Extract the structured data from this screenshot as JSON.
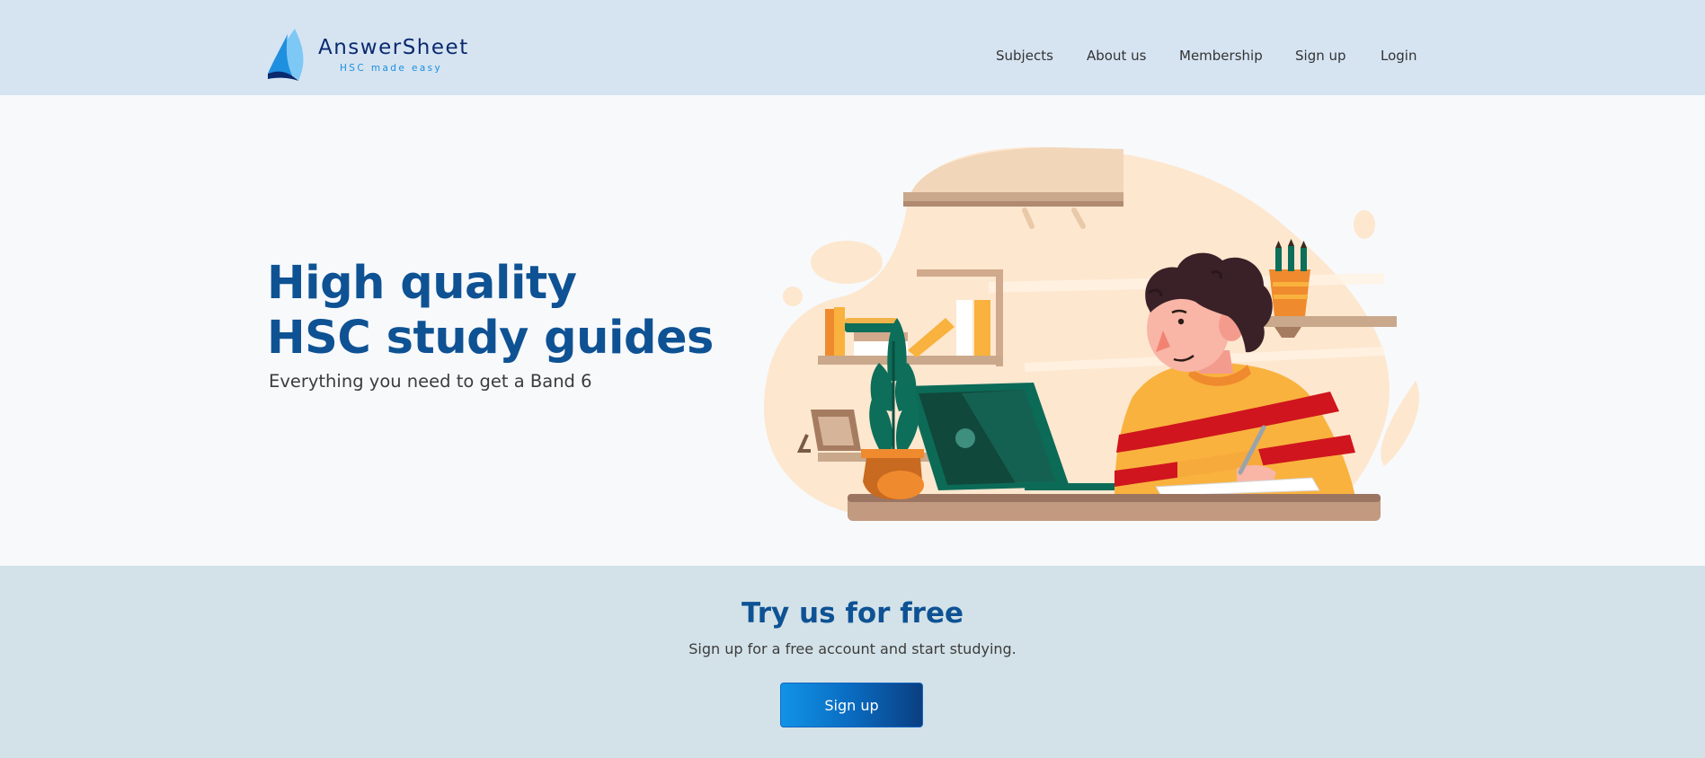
{
  "header": {
    "logo": {
      "name": "AnswerSheet",
      "tagline": "HSC made easy"
    },
    "nav": [
      {
        "label": "Subjects"
      },
      {
        "label": "About us"
      },
      {
        "label": "Membership"
      },
      {
        "label": "Sign up"
      },
      {
        "label": "Login"
      }
    ]
  },
  "hero": {
    "title_line1": "High quality",
    "title_line2": "HSC study guides",
    "subtitle": "Everything you need to get a Band 6"
  },
  "cta": {
    "title": "Try us for free",
    "subtitle": "Sign up for a free account and start studying.",
    "button_label": "Sign up"
  },
  "colors": {
    "header_bg": "#d6e4f2",
    "hero_bg": "#f8f9fb",
    "cta_bg": "#d3e2e8",
    "heading_blue": "#0e5294",
    "button_gradient": [
      "#1193e6",
      "#0a3f82"
    ]
  }
}
